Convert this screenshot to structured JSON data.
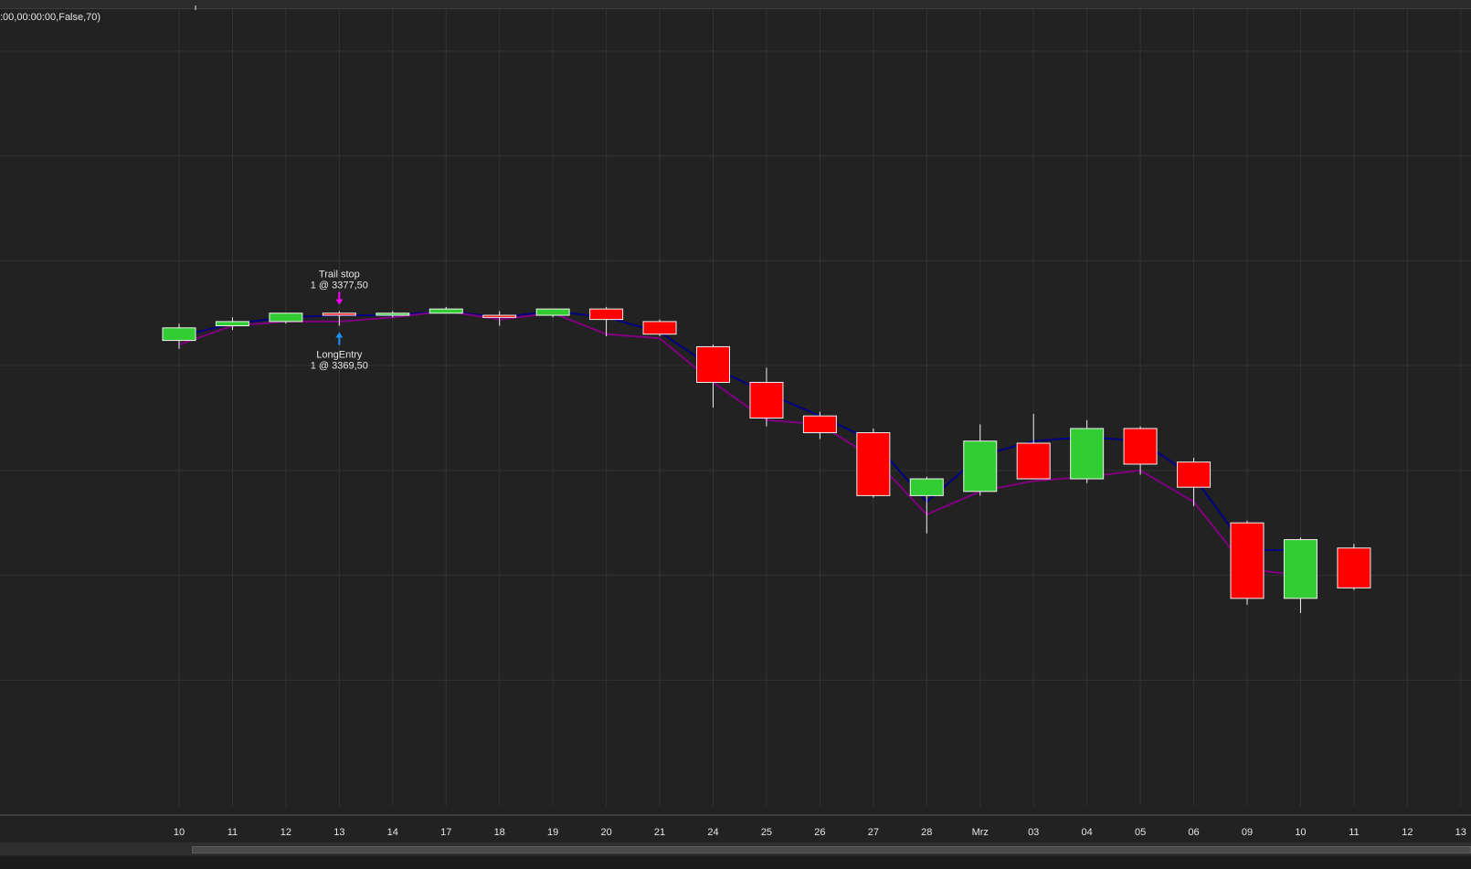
{
  "indicator_label": ":00,00:00:00,False,70)",
  "colors": {
    "background": "#222222",
    "grid": "#333333",
    "up_candle": "#32cd32",
    "down_candle": "#ff0000",
    "candle_outline": "#f0f0f0",
    "line_1": "#000080",
    "line_2": "#800080",
    "exit_marker": "#ff00ff",
    "entry_marker": "#1e90ff",
    "text": "#e6e6e6"
  },
  "chart_data": {
    "type": "candlestick",
    "ylim": [
      3140,
      3520
    ],
    "grid": true,
    "x_axis_labels": [
      "10",
      "11",
      "12",
      "13",
      "14",
      "17",
      "18",
      "19",
      "20",
      "21",
      "24",
      "25",
      "26",
      "27",
      "28",
      "Mrz",
      "03",
      "04",
      "05",
      "06",
      "09",
      "10",
      "11",
      "12",
      "13"
    ],
    "candles": [
      {
        "date": "10",
        "open": 3362,
        "high": 3370,
        "low": 3358,
        "close": 3368
      },
      {
        "date": "11",
        "open": 3369,
        "high": 3373,
        "low": 3367,
        "close": 3371
      },
      {
        "date": "12",
        "open": 3371,
        "high": 3375,
        "low": 3370,
        "close": 3375
      },
      {
        "date": "13",
        "open": 3375,
        "high": 3376,
        "low": 3369,
        "close": 3374
      },
      {
        "date": "14",
        "open": 3374,
        "high": 3376,
        "low": 3373,
        "close": 3375
      },
      {
        "date": "17",
        "open": 3375,
        "high": 3378,
        "low": 3375,
        "close": 3377
      },
      {
        "date": "18",
        "open": 3374,
        "high": 3376,
        "low": 3369,
        "close": 3373
      },
      {
        "date": "19",
        "open": 3374,
        "high": 3377,
        "low": 3373,
        "close": 3377
      },
      {
        "date": "20",
        "open": 3377,
        "high": 3378,
        "low": 3364,
        "close": 3372
      },
      {
        "date": "21",
        "open": 3371,
        "high": 3372,
        "low": 3364,
        "close": 3365
      },
      {
        "date": "24",
        "open": 3359,
        "high": 3360,
        "low": 3330,
        "close": 3342
      },
      {
        "date": "25",
        "open": 3342,
        "high": 3349,
        "low": 3321,
        "close": 3325
      },
      {
        "date": "26",
        "open": 3326,
        "high": 3328,
        "low": 3315,
        "close": 3318
      },
      {
        "date": "27",
        "open": 3318,
        "high": 3320,
        "low": 3287,
        "close": 3288
      },
      {
        "date": "28",
        "open": 3288,
        "high": 3297,
        "low": 3270,
        "close": 3296
      },
      {
        "date": "Mrz",
        "open": 3290,
        "high": 3322,
        "low": 3288,
        "close": 3314
      },
      {
        "date": "03",
        "open": 3313,
        "high": 3327,
        "low": 3300,
        "close": 3296
      },
      {
        "date": "04",
        "open": 3296,
        "high": 3324,
        "low": 3294,
        "close": 3320
      },
      {
        "date": "05",
        "open": 3320,
        "high": 3321,
        "low": 3298,
        "close": 3303
      },
      {
        "date": "06",
        "open": 3304,
        "high": 3306,
        "low": 3283,
        "close": 3292
      },
      {
        "date": "09",
        "open": 3275,
        "high": 3276,
        "low": 3236,
        "close": 3239
      },
      {
        "date": "10",
        "open": 3239,
        "high": 3268,
        "low": 3232,
        "close": 3267
      },
      {
        "date": "11",
        "open": 3263,
        "high": 3265,
        "low": 3243,
        "close": 3244
      }
    ],
    "series": [
      {
        "values": [
          3364,
          3370,
          3373,
          3374,
          3374,
          3376,
          3373,
          3376,
          3373,
          3366,
          3349,
          3337,
          3326,
          3314,
          3285,
          3307,
          3314,
          3316,
          3314,
          3297,
          3262,
          3262
        ]
      },
      {
        "values": [
          3360,
          3369,
          3371,
          3371,
          3373,
          3376,
          3372,
          3375,
          3365,
          3363,
          3342,
          3324,
          3322,
          3306,
          3279,
          3290,
          3295,
          3297,
          3300,
          3285,
          3253,
          3250
        ]
      }
    ],
    "annotations": [
      {
        "date": "13",
        "type": "exit",
        "label": "Trail stop",
        "detail": "1 @ 3377,50"
      },
      {
        "date": "13",
        "type": "entry",
        "label": "LongEntry",
        "detail": "1 @ 3369,50"
      }
    ]
  }
}
